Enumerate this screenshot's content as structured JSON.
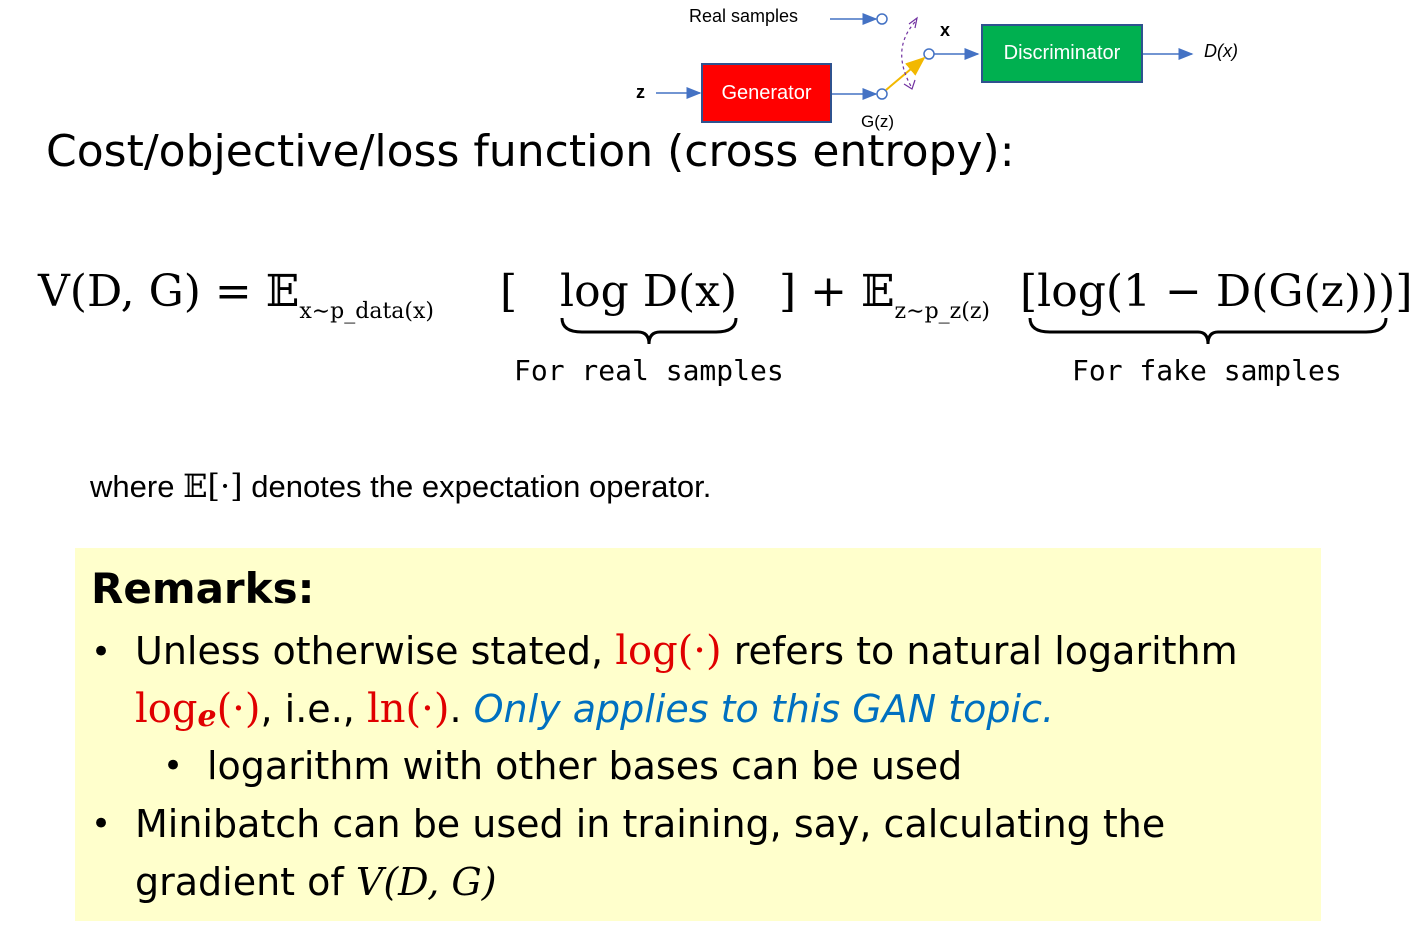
{
  "diagram": {
    "real_samples_label": "Real samples",
    "z_label": "z",
    "generator_label": "Generator",
    "gz_label": "G(z)",
    "x_label": "x",
    "discriminator_label": "Discriminator",
    "dx_label": "D(x)",
    "colors": {
      "generator": "#ff0000",
      "discriminator": "#00b050",
      "arrow": "#4472c4"
    }
  },
  "title": "Cost/objective/loss function (cross entropy):",
  "equation": {
    "lhs": "V(D, G) = 𝔼",
    "sub1": "x∼p_data(x)",
    "term1_open": "[",
    "term1": "log D(x)",
    "term1_close": "] + 𝔼",
    "sub2": "z∼p_z(z)",
    "term2": "[log(1 − D(G(z)))]",
    "brace1_label": "For real samples",
    "brace2_label": "For fake samples"
  },
  "where_text": {
    "prefix": "where",
    "math": "𝔼[·]",
    "suffix": "denotes the expectation operator."
  },
  "remarks": {
    "title": "Remarks:",
    "b1_pre": "Unless otherwise stated,",
    "b1_log": "log(·)",
    "b1_post": "refers to natural logarithm",
    "b1_loge": "log",
    "b1_loge_sub": "e",
    "b1_loge_arg": "(·)",
    "b1_ie": ", i.e.,",
    "b1_ln": "ln(·)",
    "b1_dot": ".",
    "b1_blue": "Only applies to this GAN topic.",
    "b1_sub": "logarithm with other bases can be used",
    "b2_line1": "Minibatch can be used in training, say, calculating the",
    "b2_line2_pre": "gradient of",
    "b2_line2_math": "V(D, G)"
  }
}
